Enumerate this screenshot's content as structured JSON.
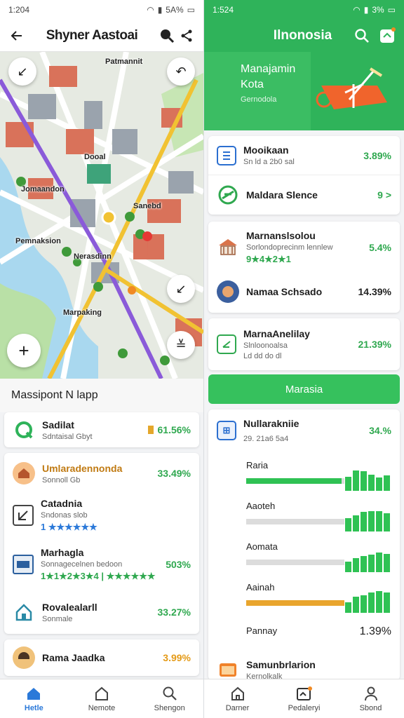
{
  "left": {
    "status": {
      "time": "1:204",
      "battery": "5A%"
    },
    "header": {
      "title": "Shyner Aastoai"
    },
    "map": {
      "labels": [
        "Patmannit",
        "Dooal",
        "Jomaandon",
        "Sanebd",
        "Pemnaksion",
        "Nerasdinn",
        "Marpaking"
      ]
    },
    "map_title": "Massipont N lapp",
    "summary": {
      "name": "Sadilat",
      "sub": "Sdntaisal Gbyt",
      "value": "61.56%"
    },
    "list": [
      {
        "name": "Umlaradennonda",
        "sub": "Sonnoll Gb",
        "value": "33.49%",
        "icon": "house-icon"
      },
      {
        "name": "Catadnia",
        "sub": "Sndonas slob",
        "stars": "1 ★★★★★★",
        "value": "",
        "icon": "building-icon"
      },
      {
        "name": "Marhagla",
        "sub": "Sonnagecelnen bedoon",
        "stars": "1★1★2★3★4 | ★★★★★★",
        "value": "503%",
        "icon": "monitor-icon"
      },
      {
        "name": "Rovalealarll",
        "sub": "Sonmale",
        "value": "33.27%",
        "icon": "home-outline-icon"
      }
    ],
    "last": {
      "name": "Rama Jaadka",
      "value": "3.99%"
    },
    "nav": [
      "Hetle",
      "Nemote",
      "Shengon"
    ]
  },
  "right": {
    "status": {
      "time": "1:524",
      "battery": "3%"
    },
    "header": {
      "title": "Ilnonosia"
    },
    "banner": {
      "line1": "Manajamin",
      "line2": "Kota",
      "line3": "Gernodola"
    },
    "card1": [
      {
        "name": "Mooikaan",
        "sub": "Sn ld a 2b0 sal",
        "value": "3.89%",
        "icon": "document-icon"
      },
      {
        "name": "Maldara Slence",
        "sub": "",
        "value": "9 >",
        "icon": "leaf-icon"
      }
    ],
    "card2": [
      {
        "name": "Marnanslsolou",
        "sub": "Sorlondoprecinm lennlew",
        "stars": "9★4★2★1",
        "value": "5.4%",
        "icon": "temple-icon"
      },
      {
        "name": "Namaa Schsado",
        "sub": "",
        "value": "14.39%",
        "icon": "avatar"
      }
    ],
    "card3": {
      "name": "MarnaAnelilay",
      "sub": "Slnloonoalsa",
      "sub2": "Ld dd do dl",
      "value": "21.39%",
      "icon": "check-square-icon"
    },
    "button": "Marasia",
    "chart_head": {
      "name": "Nullarakniie",
      "sub": "29. 21a6 5a4",
      "value": "34.%"
    },
    "chart_data": {
      "type": "bar",
      "bars": [
        {
          "label": "Raria",
          "fill": 0.97,
          "color": "#2fc254",
          "spark": [
            14,
            20,
            19,
            16,
            13,
            15
          ]
        },
        {
          "label": "Aaoteh",
          "fill": 1.0,
          "color": "#dcdcdc",
          "spark": [
            13,
            16,
            19,
            20,
            20,
            18
          ]
        },
        {
          "label": "Aomata",
          "fill": 1.0,
          "color": "#dcdcdc",
          "spark": [
            10,
            14,
            16,
            17,
            19,
            18
          ]
        },
        {
          "label": "Aainah",
          "fill": 1.0,
          "color": "#e9a52d",
          "spark": [
            10,
            16,
            17,
            20,
            21,
            20
          ]
        }
      ]
    },
    "pannay": {
      "label": "Pannay",
      "value": "1.39%"
    },
    "last": {
      "name": "Samunbrlarion",
      "sub": "Kernolkalk"
    },
    "nav": [
      "Darner",
      "Pedaleryi",
      "Sbond"
    ]
  }
}
